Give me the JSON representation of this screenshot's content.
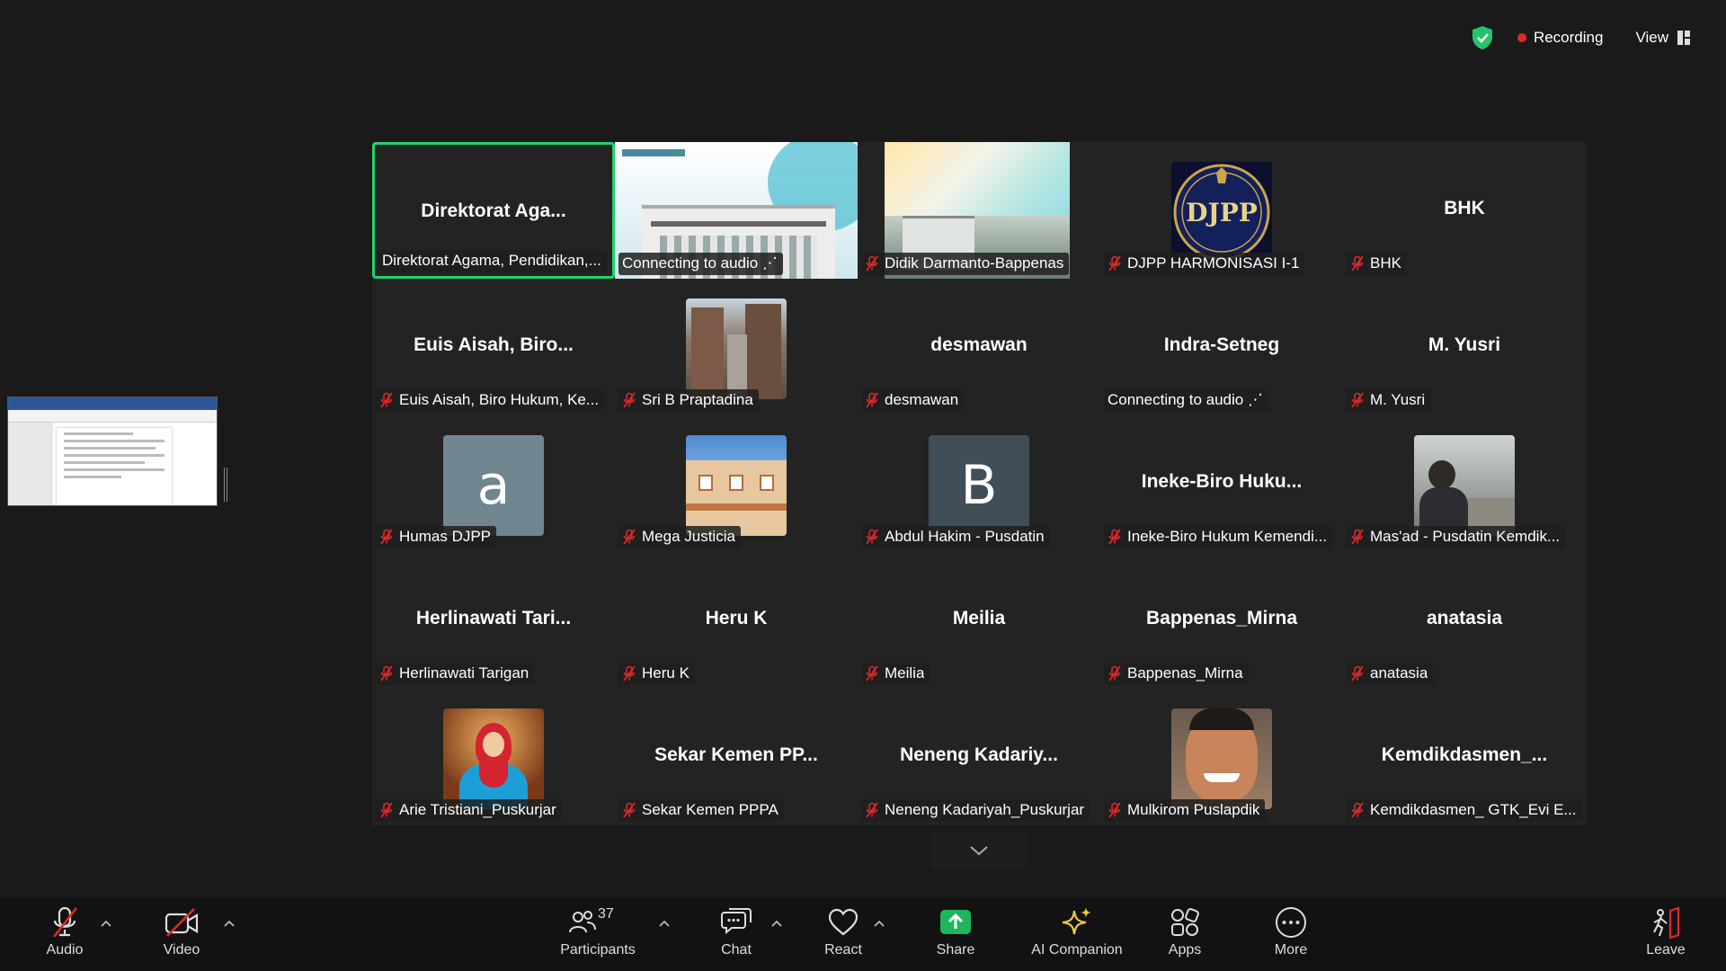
{
  "status": {
    "recording_label": "Recording",
    "view_label": "View",
    "colors": {
      "secure": "#23c46b",
      "recording": "#e02828",
      "active_speaker": "#23d16b"
    }
  },
  "participants": [
    {
      "big": "Direktorat  Aga...",
      "label": "Direktorat Agama, Pendidikan,...",
      "muted": false,
      "active": true,
      "kind": "name"
    },
    {
      "big": "",
      "label": "Connecting to audio ⋰",
      "muted": false,
      "kind": "photo-building"
    },
    {
      "big": "",
      "label": "Didik Darmanto-Bappenas",
      "muted": true,
      "kind": "photo-colorful"
    },
    {
      "big": "",
      "label": "DJPP HARMONISASI I-1",
      "muted": true,
      "kind": "logo-djpp",
      "logo_text": "DJPP"
    },
    {
      "big": "BHK",
      "label": "BHK",
      "muted": true,
      "kind": "name"
    },
    {
      "big": "Euis Aisah, Biro...",
      "label": "Euis Aisah, Biro Hukum, Ke...",
      "muted": true,
      "kind": "name"
    },
    {
      "big": "",
      "label": "Sri B Praptadina",
      "muted": true,
      "kind": "photo-street"
    },
    {
      "big": "desmawan",
      "label": "desmawan",
      "muted": true,
      "kind": "name"
    },
    {
      "big": "Indra-Setneg",
      "label": "Connecting to audio ⋰",
      "muted": false,
      "kind": "name"
    },
    {
      "big": "M. Yusri",
      "label": "M. Yusri",
      "muted": true,
      "kind": "name"
    },
    {
      "big": "",
      "label": "Humas DJPP",
      "muted": true,
      "kind": "avatar",
      "letter": "a",
      "color": "#6f8590"
    },
    {
      "big": "",
      "label": "Mega Justicia",
      "muted": true,
      "kind": "photo-house"
    },
    {
      "big": "",
      "label": "Abdul Hakim - Pusdatin",
      "muted": true,
      "kind": "avatar",
      "letter": "B",
      "color": "#3f4e57"
    },
    {
      "big": "Ineke-Biro  Huku...",
      "label": "Ineke-Biro Hukum Kemendi...",
      "muted": true,
      "kind": "name"
    },
    {
      "big": "",
      "label": "Mas'ad - Pusdatin Kemdik...",
      "muted": true,
      "kind": "photo-man"
    },
    {
      "big": "Herlinawati  Tari...",
      "label": "Herlinawati Tarigan",
      "muted": true,
      "kind": "name"
    },
    {
      "big": "Heru K",
      "label": "Heru K",
      "muted": true,
      "kind": "name"
    },
    {
      "big": "Meilia",
      "label": "Meilia",
      "muted": true,
      "kind": "name"
    },
    {
      "big": "Bappenas_Mirna",
      "label": "Bappenas_Mirna",
      "muted": true,
      "kind": "name"
    },
    {
      "big": "anatasia",
      "label": "anatasia",
      "muted": true,
      "kind": "name"
    },
    {
      "big": "",
      "label": "Arie Tristiani_Puskurjar",
      "muted": true,
      "kind": "photo-woman"
    },
    {
      "big": "Sekar  Kemen  PP...",
      "label": "Sekar Kemen PPPA",
      "muted": true,
      "kind": "name"
    },
    {
      "big": "Neneng  Kadariy...",
      "label": "Neneng Kadariyah_Puskurjar",
      "muted": true,
      "kind": "name"
    },
    {
      "big": "",
      "label": "Mulkirom Puslapdik",
      "muted": true,
      "kind": "photo-face"
    },
    {
      "big": "Kemdikdasmen_...",
      "label": "Kemdikdasmen_ GTK_Evi E...",
      "muted": true,
      "kind": "name"
    }
  ],
  "toolbar": {
    "audio": "Audio",
    "video": "Video",
    "participants": "Participants",
    "participant_count": "37",
    "chat": "Chat",
    "react": "React",
    "share": "Share",
    "ai": "AI Companion",
    "apps": "Apps",
    "more": "More",
    "leave": "Leave",
    "share_color": "#1fb55c",
    "leave_color": "#e02828"
  }
}
